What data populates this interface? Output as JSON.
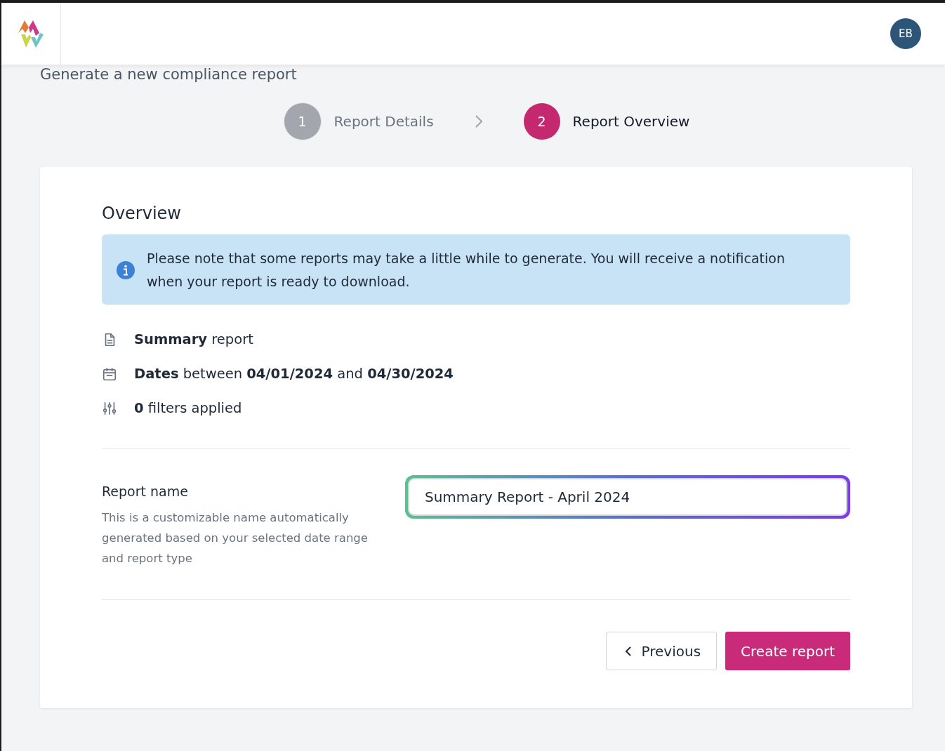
{
  "header": {
    "avatar": "EB"
  },
  "page_title": "Generate a new compliance report",
  "steps": [
    {
      "number": "1",
      "label": "Report Details",
      "selected": false
    },
    {
      "number": "2",
      "label": "Report Overview",
      "selected": true
    }
  ],
  "card": {
    "title": "Overview",
    "notice": "Please note that some reports may take a little while to generate. You will receive a notification when your report is ready to download.",
    "summary": [
      {
        "kind": "document",
        "text": "**Summary** report"
      },
      {
        "kind": "calendar",
        "text": "**Dates** between **04/01/2024** and **04/30/2024**"
      },
      {
        "kind": "filters",
        "text": "**0** filters applied"
      }
    ],
    "name_field": {
      "label": "Report name",
      "help": "This is a customizable name automatically generated based on your selected date range and report type",
      "value": "Summary Report - April 2024"
    },
    "buttons": [
      {
        "kind": "secondary",
        "label": "Previous"
      },
      {
        "kind": "primary",
        "label": "Create report"
      }
    ]
  }
}
